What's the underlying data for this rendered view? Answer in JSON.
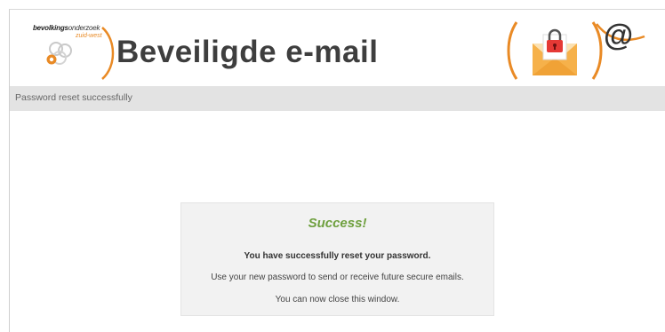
{
  "header": {
    "logo": {
      "brand_bold": "bevolkings",
      "brand_light": "onderzoek",
      "brand_sub": "zuid-west"
    },
    "title": "Beveiligde e-mail",
    "at_symbol": "@"
  },
  "status_bar": {
    "text": "Password reset successfully"
  },
  "panel": {
    "heading": "Success!",
    "line1": "You have successfully reset your password.",
    "line2": "Use your new password to send or receive future secure emails.",
    "line3": "You can now close this window."
  },
  "colors": {
    "accent_orange": "#e98a25",
    "success_green": "#6fa03f",
    "status_bar_bg": "#e3e3e3",
    "panel_bg": "#f2f2f2",
    "title_gray": "#3e3e3e"
  },
  "icons": [
    "logo-circles-icon",
    "bracket-icon",
    "envelope-lock-icon",
    "at-sign-icon"
  ]
}
